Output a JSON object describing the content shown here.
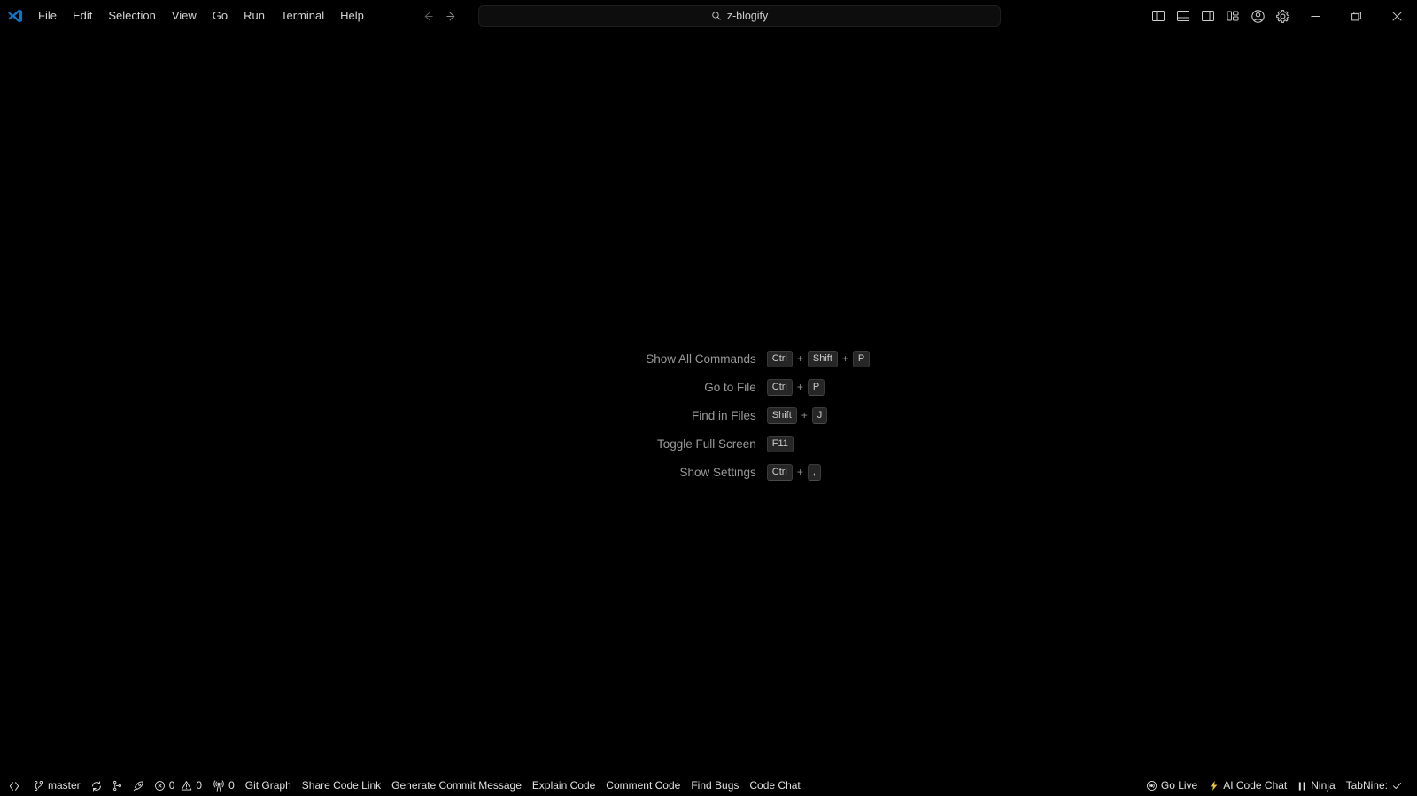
{
  "app": {
    "logo_icon": "vscode-logo-icon",
    "accent_blue": "#0f73c7",
    "background": "#000000",
    "foreground": "#cccccc"
  },
  "titlebar": {
    "menu": [
      {
        "label": "File",
        "name": "menu-file"
      },
      {
        "label": "Edit",
        "name": "menu-edit"
      },
      {
        "label": "Selection",
        "name": "menu-selection"
      },
      {
        "label": "View",
        "name": "menu-view"
      },
      {
        "label": "Go",
        "name": "menu-go"
      },
      {
        "label": "Run",
        "name": "menu-run"
      },
      {
        "label": "Terminal",
        "name": "menu-terminal"
      },
      {
        "label": "Help",
        "name": "menu-help"
      }
    ],
    "nav": {
      "back_icon": "arrow-left-icon",
      "forward_icon": "arrow-right-icon"
    },
    "search": {
      "icon": "search-icon",
      "value": "z-blogify",
      "placeholder": "Search"
    },
    "actions": [
      {
        "name": "toggle-primary-sidebar-icon",
        "title": "Toggle Primary Side Bar"
      },
      {
        "name": "toggle-panel-icon",
        "title": "Toggle Panel"
      },
      {
        "name": "toggle-secondary-sidebar-icon",
        "title": "Toggle Secondary Side Bar"
      },
      {
        "name": "customize-layout-icon",
        "title": "Customize Layout"
      },
      {
        "name": "account-icon",
        "title": "Accounts"
      },
      {
        "name": "gear-icon",
        "title": "Manage"
      }
    ],
    "window_controls": [
      {
        "name": "minimize-button",
        "glyph": "minimize-icon"
      },
      {
        "name": "restore-button",
        "glyph": "restore-icon"
      },
      {
        "name": "close-button",
        "glyph": "close-icon"
      }
    ]
  },
  "watermark": {
    "rows": [
      {
        "label": "Show All Commands",
        "keys": [
          "Ctrl",
          "Shift",
          "P"
        ]
      },
      {
        "label": "Go to File",
        "keys": [
          "Ctrl",
          "P"
        ]
      },
      {
        "label": "Find in Files",
        "keys": [
          "Shift",
          "J"
        ]
      },
      {
        "label": "Toggle Full Screen",
        "keys": [
          "F11"
        ]
      },
      {
        "label": "Show Settings",
        "keys": [
          "Ctrl",
          ","
        ]
      }
    ],
    "separator": "+"
  },
  "statusbar": {
    "left": [
      {
        "name": "remote-indicator",
        "icon": "remote-window-icon",
        "label": ""
      },
      {
        "name": "status-git-branch",
        "icon": "source-control-icon",
        "label": "master"
      },
      {
        "name": "status-sync-changes",
        "icon": "sync-icon",
        "label": ""
      },
      {
        "name": "status-git-branch-extra",
        "icon": "git-branch-icon",
        "label": ""
      },
      {
        "name": "status-rocket",
        "icon": "rocket-icon",
        "label": ""
      },
      {
        "name": "status-problems",
        "icon": "error-warning-icon",
        "errors": "0",
        "warnings": "0"
      },
      {
        "name": "status-ports",
        "icon": "radio-tower-icon",
        "label": "0"
      },
      {
        "name": "status-git-graph",
        "label": "Git Graph"
      },
      {
        "name": "status-share-code-link",
        "label": "Share Code Link"
      },
      {
        "name": "status-generate-commit-message",
        "label": "Generate Commit Message"
      },
      {
        "name": "status-explain-code",
        "label": "Explain Code"
      },
      {
        "name": "status-comment-code",
        "label": "Comment Code"
      },
      {
        "name": "status-find-bugs",
        "label": "Find Bugs"
      },
      {
        "name": "status-code-chat",
        "label": "Code Chat"
      }
    ],
    "right": [
      {
        "name": "status-go-live",
        "icon": "broadcast-icon",
        "label": "Go Live"
      },
      {
        "name": "status-ai-code-chat",
        "icon": "lightning-icon",
        "label": "AI Code Chat",
        "icon_color": "#e8c447"
      },
      {
        "name": "status-ninja",
        "icon": "pause-icon",
        "label": "Ninja"
      },
      {
        "name": "status-tabnine",
        "label": "TabNine:",
        "check": "check-icon"
      }
    ]
  }
}
